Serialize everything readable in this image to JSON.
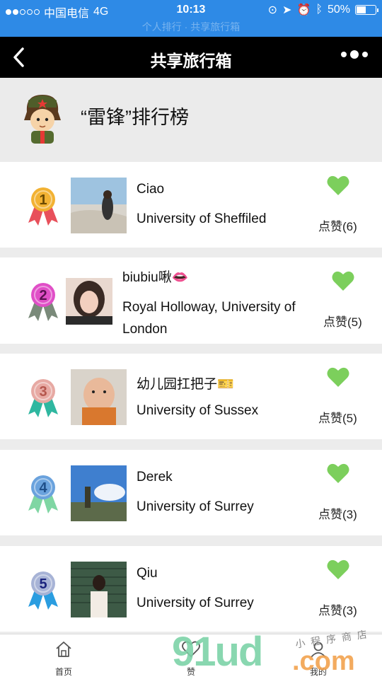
{
  "status_bar": {
    "carrier": "中国电信",
    "network": "4G",
    "time": "10:13",
    "battery": "50%",
    "battery_level": 0.5,
    "faint_text": "个人排行 · 共享旅行箱"
  },
  "nav": {
    "title": "共享旅行箱",
    "back_icon": "back-arrow-icon",
    "more_icon": "more-dots-icon"
  },
  "banner": {
    "title": "“雷锋”排行榜",
    "mascot_icon": "lei-feng-mascot-icon"
  },
  "colors": {
    "status_blue": "#2e8ae6",
    "heart_green": "#7ccf5c",
    "nav_black": "#000000"
  },
  "ranking": [
    {
      "rank": "1",
      "name": "Ciao",
      "school": "University of Sheffiled",
      "likes": "点赞(6)",
      "medal_color": "#f2b233",
      "ribbon_color": "#e8505b"
    },
    {
      "rank": "2",
      "name": "biubiu啾👄",
      "school": "Royal Holloway, University of London",
      "likes": "点赞(5)",
      "medal_color": "#e04fc7",
      "ribbon_color": "#7a8a7a"
    },
    {
      "rank": "3",
      "name": "幼儿园扛把子🎫",
      "school": "University of Sussex",
      "likes": "点赞(5)",
      "medal_color": "#e7a9a3",
      "ribbon_color": "#2fb7a0"
    },
    {
      "rank": "4",
      "name": "Derek",
      "school": "University of Surrey",
      "likes": "点赞(3)",
      "medal_color": "#6aa2dd",
      "ribbon_color": "#7fd6a3"
    },
    {
      "rank": "5",
      "name": "Qiu",
      "school": "University of Surrey",
      "likes": "点赞(3)",
      "medal_color": "#a7b3d6",
      "ribbon_color": "#2a9de0"
    }
  ],
  "tabbar": {
    "tabs": [
      {
        "label": "首页",
        "icon": "home-icon"
      },
      {
        "label": "赞",
        "icon": "like-heart-icon"
      },
      {
        "label": "我的",
        "icon": "user-icon"
      }
    ]
  },
  "watermark": {
    "main": "91ud",
    "suffix": ".com",
    "tagline": "小程序商店"
  }
}
